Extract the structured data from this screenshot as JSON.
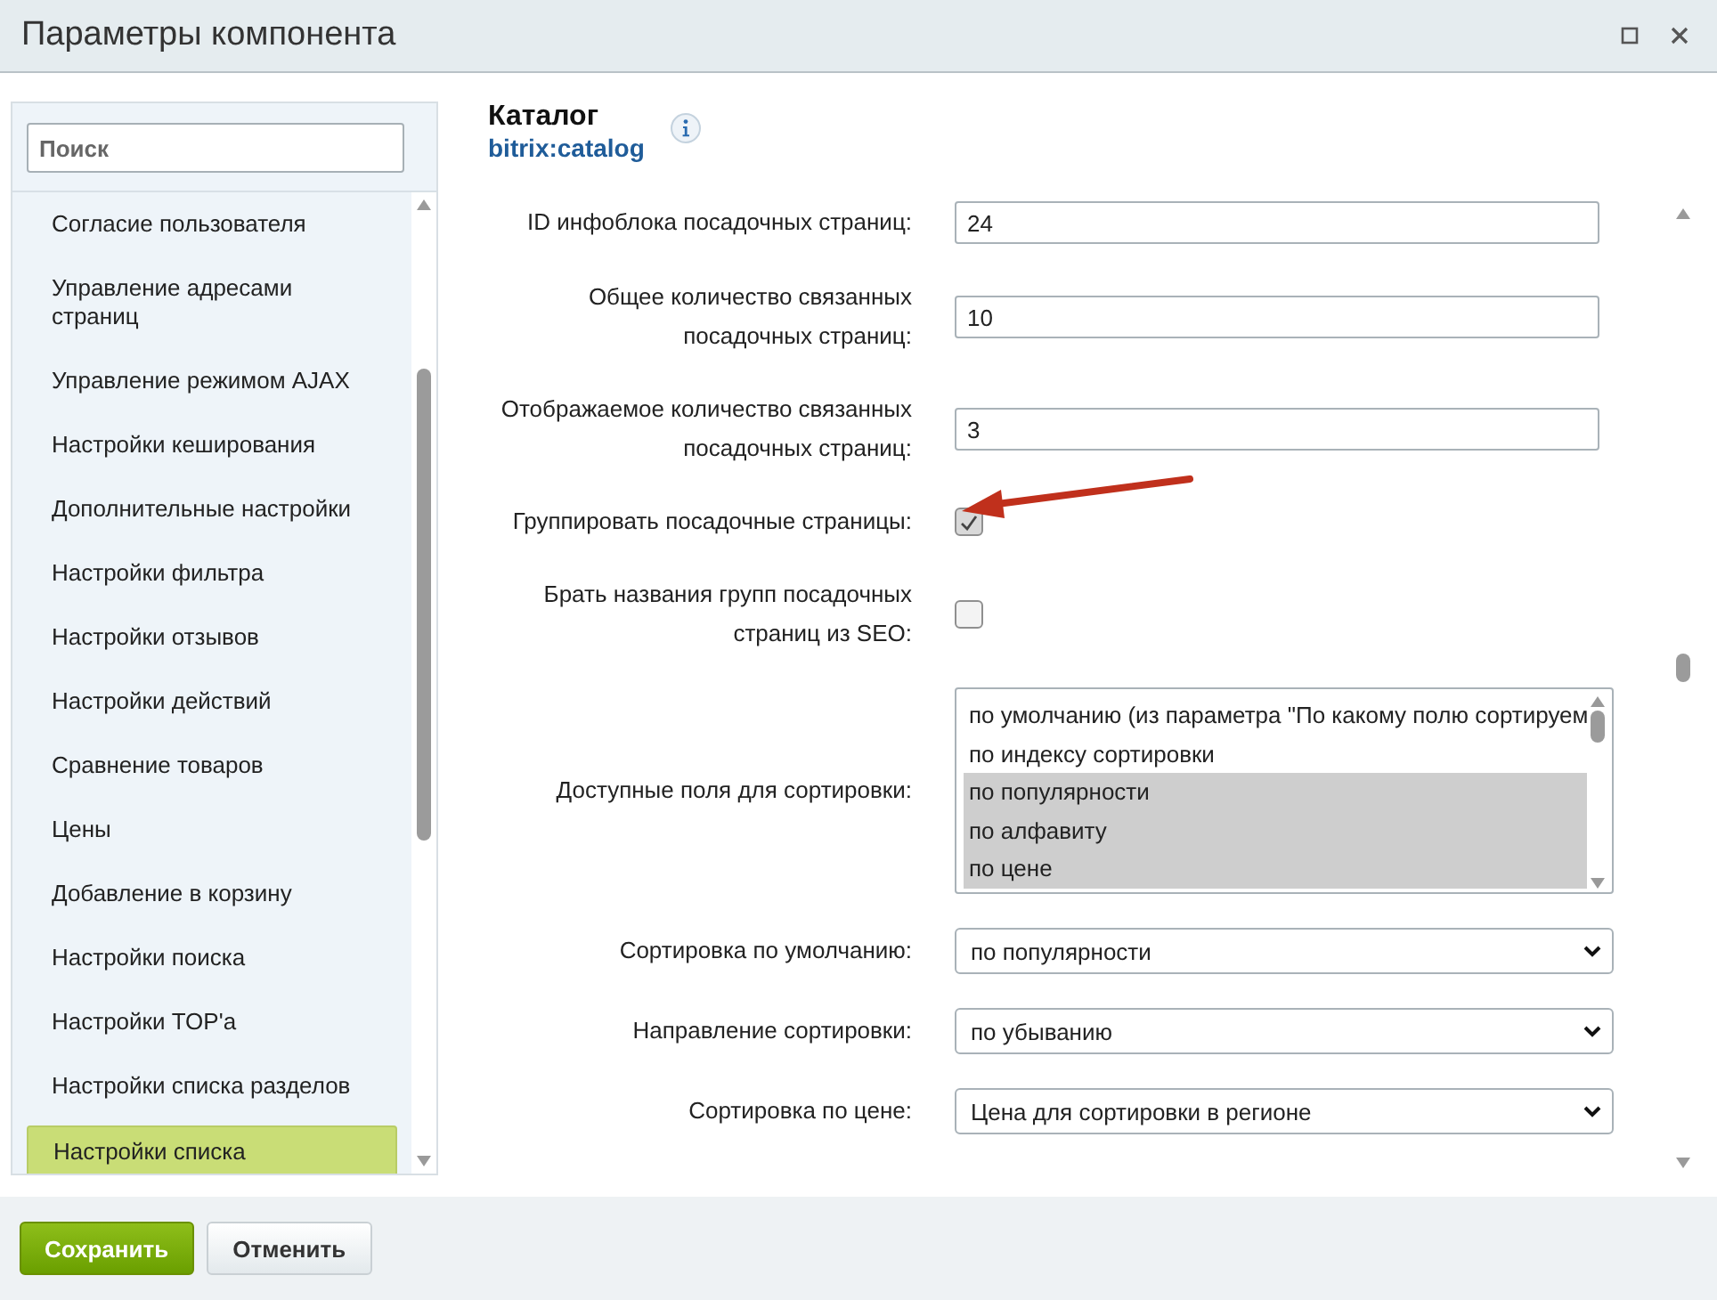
{
  "window": {
    "title": "Параметры компонента"
  },
  "sidebar": {
    "search": {
      "placeholder": "Поиск"
    },
    "items": [
      {
        "label": "Согласие пользователя",
        "selected": false
      },
      {
        "label": "Управление адресами страниц",
        "selected": false
      },
      {
        "label": "Управление режимом AJAX",
        "selected": false
      },
      {
        "label": "Настройки кеширования",
        "selected": false
      },
      {
        "label": "Дополнительные настройки",
        "selected": false
      },
      {
        "label": "Настройки фильтра",
        "selected": false
      },
      {
        "label": "Настройки отзывов",
        "selected": false
      },
      {
        "label": "Настройки действий",
        "selected": false
      },
      {
        "label": "Сравнение товаров",
        "selected": false
      },
      {
        "label": "Цены",
        "selected": false
      },
      {
        "label": "Добавление в корзину",
        "selected": false
      },
      {
        "label": "Настройки поиска",
        "selected": false
      },
      {
        "label": "Настройки TOP'а",
        "selected": false
      },
      {
        "label": "Настройки списка разделов",
        "selected": false
      },
      {
        "label": "Настройки списка",
        "selected": true
      }
    ]
  },
  "component": {
    "title": "Каталог",
    "code": "bitrix:catalog"
  },
  "fields": [
    {
      "kind": "text",
      "label": "ID инфоблока посадочных страниц:",
      "value": "24"
    },
    {
      "kind": "text",
      "label": "Общее количество связанных посадочных страниц:",
      "value": "10"
    },
    {
      "kind": "text",
      "label": "Отображаемое количество связанных посадочных страниц:",
      "value": "3"
    },
    {
      "kind": "checkbox",
      "label": "Группировать посадочные страницы:",
      "checked": true
    },
    {
      "kind": "checkbox",
      "label": "Брать названия групп посадочных страниц из SEO:",
      "checked": false
    },
    {
      "kind": "listbox",
      "label": "Доступные поля для сортировки:",
      "options": [
        {
          "label": "по умолчанию (из параметра \"По какому полю сортируем",
          "selected": false
        },
        {
          "label": "по индексу сортировки",
          "selected": false
        },
        {
          "label": "по популярности",
          "selected": true
        },
        {
          "label": "по алфавиту",
          "selected": true
        },
        {
          "label": "по цене",
          "selected": true
        }
      ]
    },
    {
      "kind": "select",
      "label": "Сортировка по умолчанию:",
      "value": "по популярности"
    },
    {
      "kind": "select",
      "label": "Направление сортировки:",
      "value": "по убыванию"
    },
    {
      "kind": "select",
      "label": "Сортировка по цене:",
      "value": "Цена для сортировки в регионе"
    }
  ],
  "buttons": [
    {
      "label": "Сохранить",
      "kind": "primary"
    },
    {
      "label": "Отменить",
      "kind": "secondary"
    }
  ]
}
